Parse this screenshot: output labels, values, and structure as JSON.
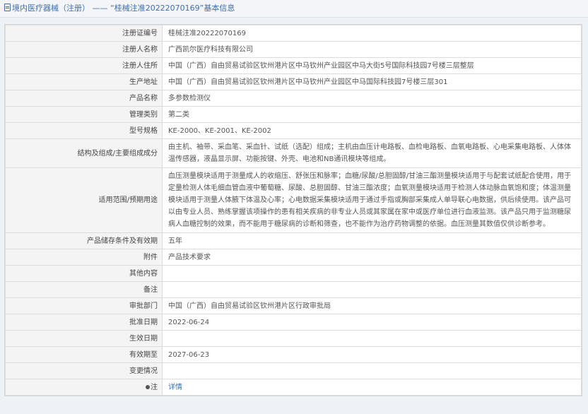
{
  "header": {
    "title": "境内医疗器械（注册） —— “桂械注准20222070169”基本信息"
  },
  "rows": [
    {
      "label": "注册证编号",
      "value": "桂械注准20222070169"
    },
    {
      "label": "注册人名称",
      "value": "广西凯尔医疗科技有限公司"
    },
    {
      "label": "注册人住所",
      "value": "中国（广西）自由贸易试验区钦州港片区中马钦州产业园区中马大街5号国际科技园7号楼三层整层"
    },
    {
      "label": "生产地址",
      "value": "中国（广西）自由贸易试验区钦州港片区中马钦州产业园区中马国际科技园7号楼三层301"
    },
    {
      "label": "产品名称",
      "value": "多参数检测仪"
    },
    {
      "label": "管理类别",
      "value": "第二类"
    },
    {
      "label": "型号规格",
      "value": "KE-2000、KE-2001、KE-2002"
    },
    {
      "label": "结构及组成/主要组成成分",
      "value": "由主机、袖带、采血笔、采血针、试纸（选配）组成；主机由血压计电路板、血检电路板、血氧电路板、心电采集电路板、人体体温传感器，液晶显示屏、功能按键、外壳、电池和NB通讯模块等组成。"
    },
    {
      "label": "适用范围/预期用途",
      "value": "血压测量模块适用于测量成人的收缩压、舒张压和脉率；血糖/尿酸/总胆固醇/甘油三酯测量模块适用于与配套试纸配合使用，用于定量检测人体毛细血管血液中葡萄糖、尿酸、总胆固醇、甘油三酯浓度；血氧测量模块适用于检测人体动脉血氧饱和度；体温测量模块适用于测量人体腋下体温及心率；心电数据采集模块适用于通过手指或胸部采集成人单导联心电数据，供后续使用。该产品可以由专业人员、熟练掌握该项操作的患有相关疾病的非专业人员或其家属在家中或医疗单位进行血液监测。该产品只用于监测糖尿病人血糖控制的效果，而不能用于糖尿病的诊断和筛查，也不能作为治疗药物调整的依据。血压测量其数值仅供诊断参考。"
    },
    {
      "label": "产品储存条件及有效期",
      "value": "五年"
    },
    {
      "label": "附件",
      "value": "产品技术要求"
    },
    {
      "label": "其他内容",
      "value": ""
    },
    {
      "label": "备注",
      "value": ""
    },
    {
      "label": "审批部门",
      "value": "中国（广西）自由贸易试验区钦州港片区行政审批局"
    },
    {
      "label": "批准日期",
      "value": "2022-06-24"
    },
    {
      "label": "生效日期",
      "value": ""
    },
    {
      "label": "有效期至",
      "value": "2027-06-23"
    },
    {
      "label": "变更情况",
      "value": ""
    },
    {
      "label": "注",
      "value": "详情",
      "icon": "pin-icon"
    }
  ]
}
